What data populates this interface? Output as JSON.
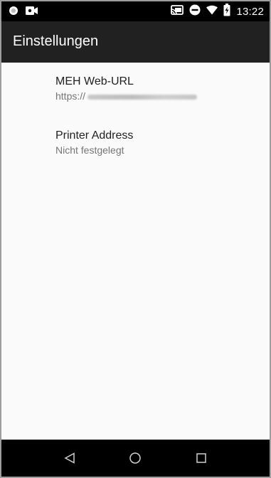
{
  "status_bar": {
    "time": "13:22",
    "left_icons": [
      "notification-dot-icon",
      "video-camera-icon"
    ],
    "right_icons": [
      "cast-icon",
      "do-not-disturb-icon",
      "wifi-icon",
      "battery-charging-icon"
    ]
  },
  "app_bar": {
    "title": "Einstellungen"
  },
  "preferences": [
    {
      "title": "MEH Web-URL",
      "summary": "https://"
    },
    {
      "title": "Printer Address",
      "summary": "Nicht festgelegt"
    }
  ],
  "nav_bar": {
    "buttons": [
      "back-icon",
      "home-icon",
      "recents-icon"
    ]
  }
}
